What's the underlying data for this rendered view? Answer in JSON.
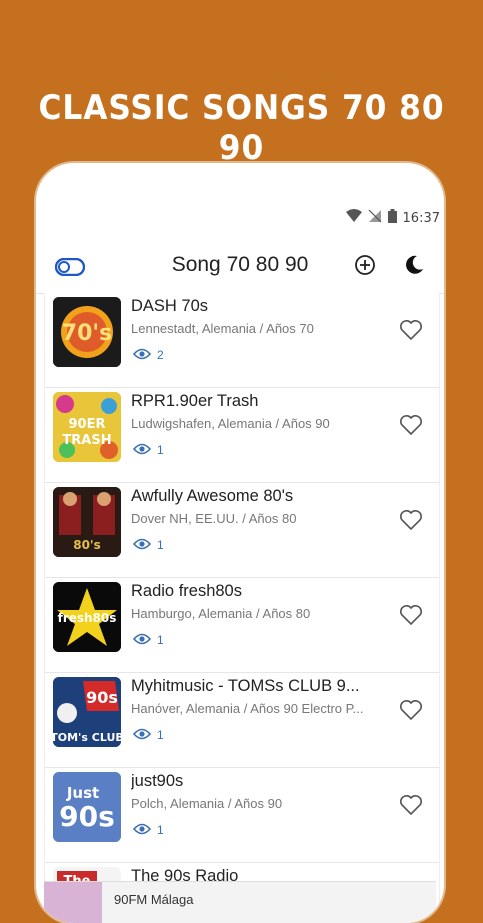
{
  "promo": {
    "title": "CLASSIC SONGS 70 80 90"
  },
  "status_bar": {
    "time": "16:37"
  },
  "app_bar": {
    "title": "Song 70 80 90"
  },
  "stations": [
    {
      "name": "DASH 70s",
      "location": "Lennestadt, Alemania / Años 70",
      "views": "2",
      "logo_text": "70's",
      "logo_bg": "#1b1b1b",
      "logo_fg": "#f1a21a"
    },
    {
      "name": "RPR1.90er Trash",
      "location": "Ludwigshafen, Alemania / Años 90",
      "views": "1",
      "logo_text": "90ER TRASH",
      "logo_bg": "#e9c53a",
      "logo_fg": "#ffffff"
    },
    {
      "name": "Awfully Awesome 80's",
      "location": "Dover NH, EE.UU. / Años 80",
      "views": "1",
      "logo_text": "80's",
      "logo_bg": "#2a1a14",
      "logo_fg": "#e3c04a"
    },
    {
      "name": "Radio fresh80s",
      "location": "Hamburgo, Alemania / Años 80",
      "views": "1",
      "logo_text": "fresh80s",
      "logo_bg": "#0a0a0a",
      "logo_fg": "#f2d21c"
    },
    {
      "name": "Myhitmusic - TOMSs CLUB 9...",
      "location": "Hanóver, Alemania / Años 90 Electro P...",
      "views": "1",
      "logo_text": "TOM's CLUB",
      "logo_bg": "#1d3f7a",
      "logo_fg": "#ffffff"
    },
    {
      "name": "just90s",
      "location": "Polch, Alemania / Años 90",
      "views": "1",
      "logo_text": "Just 90s",
      "logo_bg": "#5a7fc4",
      "logo_fg": "#ffffff"
    },
    {
      "name": "The 90s Radio",
      "location": "",
      "views": "",
      "logo_text": "The",
      "logo_bg": "#c92a2a",
      "logo_fg": "#ffffff"
    }
  ],
  "mini_player": {
    "title": "90FM Málaga"
  },
  "colors": {
    "background": "#c5701f",
    "accent": "#3a6fb5"
  }
}
